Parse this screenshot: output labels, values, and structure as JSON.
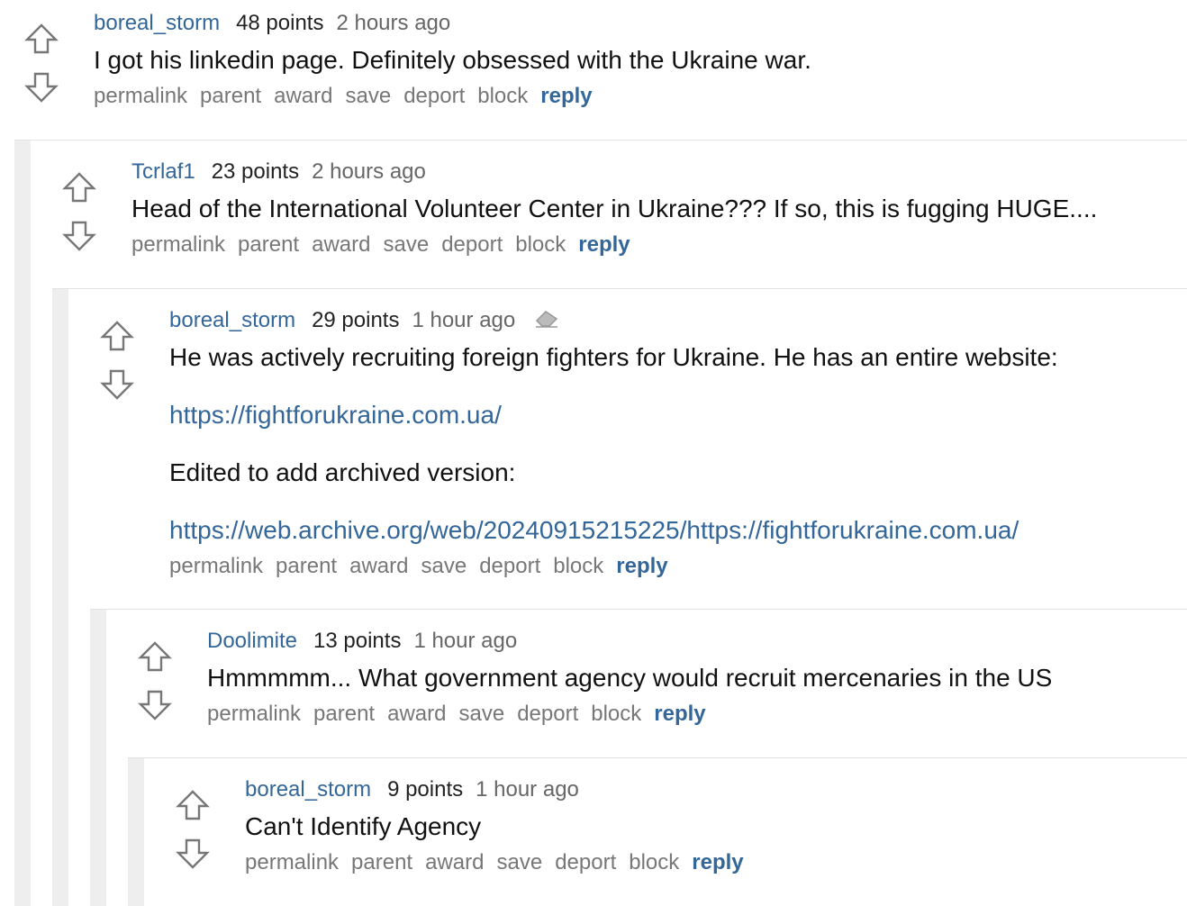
{
  "colors": {
    "link": "#336699",
    "rail": "#eeeeee",
    "muted": "#777777",
    "arrow_stroke": "#777777"
  },
  "icons": {
    "upvote": "up-arrow-icon",
    "downvote": "down-arrow-icon",
    "edited": "eraser-icon"
  },
  "action_labels": {
    "permalink": "permalink",
    "parent": "parent",
    "award": "award",
    "save": "save",
    "deport": "deport",
    "block": "block",
    "reply": "reply"
  },
  "comments": [
    {
      "author": "boreal_storm",
      "score": "48 points",
      "time": "2 hours ago",
      "paragraphs": [
        "I got his linkedin page. Definitely obsessed with the Ukraine war."
      ]
    },
    {
      "author": "Tcrlaf1",
      "score": "23 points",
      "time": "2 hours ago",
      "paragraphs": [
        "Head of the International Volunteer Center in Ukraine??? If so, this is fugging HUGE...."
      ]
    },
    {
      "author": "boreal_storm",
      "score": "29 points",
      "time": "1 hour ago",
      "edited": true,
      "paragraphs": [
        "He was actively recruiting foreign fighters for Ukraine. He has an entire website:",
        "https://fightforukraine.com.ua/",
        "Edited to add archived version:",
        "https://web.archive.org/web/20240915215225/https://fightforukraine.com.ua/"
      ]
    },
    {
      "author": "Doolimite",
      "score": "13 points",
      "time": "1 hour ago",
      "paragraphs": [
        "Hmmmmm... What government agency would recruit mercenaries in the US"
      ]
    },
    {
      "author": "boreal_storm",
      "score": "9 points",
      "time": "1 hour ago",
      "paragraphs": [
        "Can't Identify Agency"
      ]
    }
  ]
}
